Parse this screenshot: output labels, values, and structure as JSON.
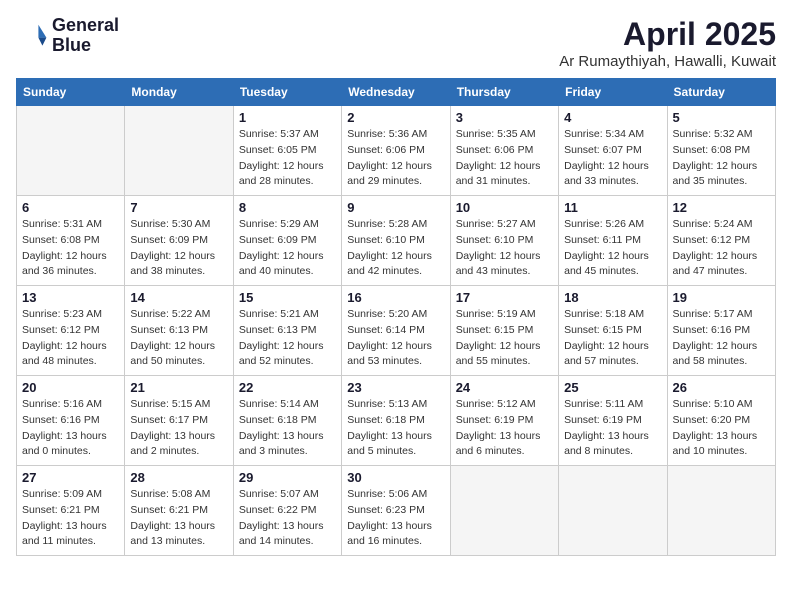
{
  "header": {
    "logo_line1": "General",
    "logo_line2": "Blue",
    "month_title": "April 2025",
    "location": "Ar Rumaythiyah, Hawalli, Kuwait"
  },
  "weekdays": [
    "Sunday",
    "Monday",
    "Tuesday",
    "Wednesday",
    "Thursday",
    "Friday",
    "Saturday"
  ],
  "weeks": [
    [
      {
        "day": "",
        "sunrise": "",
        "sunset": "",
        "daylight": ""
      },
      {
        "day": "",
        "sunrise": "",
        "sunset": "",
        "daylight": ""
      },
      {
        "day": "1",
        "sunrise": "Sunrise: 5:37 AM",
        "sunset": "Sunset: 6:05 PM",
        "daylight": "Daylight: 12 hours and 28 minutes."
      },
      {
        "day": "2",
        "sunrise": "Sunrise: 5:36 AM",
        "sunset": "Sunset: 6:06 PM",
        "daylight": "Daylight: 12 hours and 29 minutes."
      },
      {
        "day": "3",
        "sunrise": "Sunrise: 5:35 AM",
        "sunset": "Sunset: 6:06 PM",
        "daylight": "Daylight: 12 hours and 31 minutes."
      },
      {
        "day": "4",
        "sunrise": "Sunrise: 5:34 AM",
        "sunset": "Sunset: 6:07 PM",
        "daylight": "Daylight: 12 hours and 33 minutes."
      },
      {
        "day": "5",
        "sunrise": "Sunrise: 5:32 AM",
        "sunset": "Sunset: 6:08 PM",
        "daylight": "Daylight: 12 hours and 35 minutes."
      }
    ],
    [
      {
        "day": "6",
        "sunrise": "Sunrise: 5:31 AM",
        "sunset": "Sunset: 6:08 PM",
        "daylight": "Daylight: 12 hours and 36 minutes."
      },
      {
        "day": "7",
        "sunrise": "Sunrise: 5:30 AM",
        "sunset": "Sunset: 6:09 PM",
        "daylight": "Daylight: 12 hours and 38 minutes."
      },
      {
        "day": "8",
        "sunrise": "Sunrise: 5:29 AM",
        "sunset": "Sunset: 6:09 PM",
        "daylight": "Daylight: 12 hours and 40 minutes."
      },
      {
        "day": "9",
        "sunrise": "Sunrise: 5:28 AM",
        "sunset": "Sunset: 6:10 PM",
        "daylight": "Daylight: 12 hours and 42 minutes."
      },
      {
        "day": "10",
        "sunrise": "Sunrise: 5:27 AM",
        "sunset": "Sunset: 6:10 PM",
        "daylight": "Daylight: 12 hours and 43 minutes."
      },
      {
        "day": "11",
        "sunrise": "Sunrise: 5:26 AM",
        "sunset": "Sunset: 6:11 PM",
        "daylight": "Daylight: 12 hours and 45 minutes."
      },
      {
        "day": "12",
        "sunrise": "Sunrise: 5:24 AM",
        "sunset": "Sunset: 6:12 PM",
        "daylight": "Daylight: 12 hours and 47 minutes."
      }
    ],
    [
      {
        "day": "13",
        "sunrise": "Sunrise: 5:23 AM",
        "sunset": "Sunset: 6:12 PM",
        "daylight": "Daylight: 12 hours and 48 minutes."
      },
      {
        "day": "14",
        "sunrise": "Sunrise: 5:22 AM",
        "sunset": "Sunset: 6:13 PM",
        "daylight": "Daylight: 12 hours and 50 minutes."
      },
      {
        "day": "15",
        "sunrise": "Sunrise: 5:21 AM",
        "sunset": "Sunset: 6:13 PM",
        "daylight": "Daylight: 12 hours and 52 minutes."
      },
      {
        "day": "16",
        "sunrise": "Sunrise: 5:20 AM",
        "sunset": "Sunset: 6:14 PM",
        "daylight": "Daylight: 12 hours and 53 minutes."
      },
      {
        "day": "17",
        "sunrise": "Sunrise: 5:19 AM",
        "sunset": "Sunset: 6:15 PM",
        "daylight": "Daylight: 12 hours and 55 minutes."
      },
      {
        "day": "18",
        "sunrise": "Sunrise: 5:18 AM",
        "sunset": "Sunset: 6:15 PM",
        "daylight": "Daylight: 12 hours and 57 minutes."
      },
      {
        "day": "19",
        "sunrise": "Sunrise: 5:17 AM",
        "sunset": "Sunset: 6:16 PM",
        "daylight": "Daylight: 12 hours and 58 minutes."
      }
    ],
    [
      {
        "day": "20",
        "sunrise": "Sunrise: 5:16 AM",
        "sunset": "Sunset: 6:16 PM",
        "daylight": "Daylight: 13 hours and 0 minutes."
      },
      {
        "day": "21",
        "sunrise": "Sunrise: 5:15 AM",
        "sunset": "Sunset: 6:17 PM",
        "daylight": "Daylight: 13 hours and 2 minutes."
      },
      {
        "day": "22",
        "sunrise": "Sunrise: 5:14 AM",
        "sunset": "Sunset: 6:18 PM",
        "daylight": "Daylight: 13 hours and 3 minutes."
      },
      {
        "day": "23",
        "sunrise": "Sunrise: 5:13 AM",
        "sunset": "Sunset: 6:18 PM",
        "daylight": "Daylight: 13 hours and 5 minutes."
      },
      {
        "day": "24",
        "sunrise": "Sunrise: 5:12 AM",
        "sunset": "Sunset: 6:19 PM",
        "daylight": "Daylight: 13 hours and 6 minutes."
      },
      {
        "day": "25",
        "sunrise": "Sunrise: 5:11 AM",
        "sunset": "Sunset: 6:19 PM",
        "daylight": "Daylight: 13 hours and 8 minutes."
      },
      {
        "day": "26",
        "sunrise": "Sunrise: 5:10 AM",
        "sunset": "Sunset: 6:20 PM",
        "daylight": "Daylight: 13 hours and 10 minutes."
      }
    ],
    [
      {
        "day": "27",
        "sunrise": "Sunrise: 5:09 AM",
        "sunset": "Sunset: 6:21 PM",
        "daylight": "Daylight: 13 hours and 11 minutes."
      },
      {
        "day": "28",
        "sunrise": "Sunrise: 5:08 AM",
        "sunset": "Sunset: 6:21 PM",
        "daylight": "Daylight: 13 hours and 13 minutes."
      },
      {
        "day": "29",
        "sunrise": "Sunrise: 5:07 AM",
        "sunset": "Sunset: 6:22 PM",
        "daylight": "Daylight: 13 hours and 14 minutes."
      },
      {
        "day": "30",
        "sunrise": "Sunrise: 5:06 AM",
        "sunset": "Sunset: 6:23 PM",
        "daylight": "Daylight: 13 hours and 16 minutes."
      },
      {
        "day": "",
        "sunrise": "",
        "sunset": "",
        "daylight": ""
      },
      {
        "day": "",
        "sunrise": "",
        "sunset": "",
        "daylight": ""
      },
      {
        "day": "",
        "sunrise": "",
        "sunset": "",
        "daylight": ""
      }
    ]
  ]
}
